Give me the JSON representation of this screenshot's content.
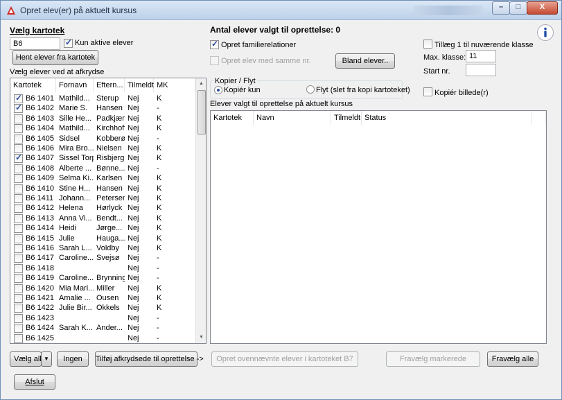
{
  "window": {
    "title": "Opret elev(er) på aktuelt kursus",
    "minimize": "–",
    "maximize": "□",
    "close": "X"
  },
  "left": {
    "heading": "Vælg kartotek",
    "kartotek_value": "B6",
    "only_active_label": "Kun aktive elever",
    "fetch_button": "Hent elever fra kartotek",
    "select_caption": "Vælg elever ved at afkrydse",
    "columns": [
      "Kartotek",
      "Fornavn",
      "Eftern...",
      "Tilmeldt",
      "MK"
    ],
    "rows": [
      {
        "checked": true,
        "kartotek": "B6  1401",
        "fornavn": "Mathild...",
        "efternavn": "Sterup",
        "tilmeldt": "Nej",
        "mk": "K"
      },
      {
        "checked": true,
        "kartotek": "B6  1402",
        "fornavn": "Marie S.",
        "efternavn": "Hansen",
        "tilmeldt": "Nej",
        "mk": "-"
      },
      {
        "checked": false,
        "kartotek": "B6  1403",
        "fornavn": "Sille He...",
        "efternavn": "Padkjær",
        "tilmeldt": "Nej",
        "mk": "K"
      },
      {
        "checked": false,
        "kartotek": "B6  1404",
        "fornavn": "Mathild...",
        "efternavn": "Kirchhoff",
        "tilmeldt": "Nej",
        "mk": "K"
      },
      {
        "checked": false,
        "kartotek": "B6  1405",
        "fornavn": "Sidsel",
        "efternavn": "Kobberø",
        "tilmeldt": "Nej",
        "mk": "-"
      },
      {
        "checked": false,
        "kartotek": "B6  1406",
        "fornavn": "Mira Bro...",
        "efternavn": "Nielsen",
        "tilmeldt": "Nej",
        "mk": "K"
      },
      {
        "checked": true,
        "kartotek": "B6  1407",
        "fornavn": "Sissel Torp",
        "efternavn": "Risbjerg",
        "tilmeldt": "Nej",
        "mk": "K"
      },
      {
        "checked": false,
        "kartotek": "B6  1408",
        "fornavn": "Alberte ...",
        "efternavn": "Bønne...",
        "tilmeldt": "Nej",
        "mk": "-"
      },
      {
        "checked": false,
        "kartotek": "B6  1409",
        "fornavn": "Selma Ki...",
        "efternavn": "Karlsen",
        "tilmeldt": "Nej",
        "mk": "K"
      },
      {
        "checked": false,
        "kartotek": "B6  1410",
        "fornavn": "Stine H...",
        "efternavn": "Hansen",
        "tilmeldt": "Nej",
        "mk": "K"
      },
      {
        "checked": false,
        "kartotek": "B6  1411",
        "fornavn": "Johann...",
        "efternavn": "Petersen",
        "tilmeldt": "Nej",
        "mk": "K"
      },
      {
        "checked": false,
        "kartotek": "B6  1412",
        "fornavn": "Helena",
        "efternavn": "Hørlyck",
        "tilmeldt": "Nej",
        "mk": "K"
      },
      {
        "checked": false,
        "kartotek": "B6  1413",
        "fornavn": "Anna Vi...",
        "efternavn": "Bendt...",
        "tilmeldt": "Nej",
        "mk": "K"
      },
      {
        "checked": false,
        "kartotek": "B6  1414",
        "fornavn": "Heidi",
        "efternavn": "Jørge...",
        "tilmeldt": "Nej",
        "mk": "K"
      },
      {
        "checked": false,
        "kartotek": "B6  1415",
        "fornavn": "Julie",
        "efternavn": "Hauga...",
        "tilmeldt": "Nej",
        "mk": "K"
      },
      {
        "checked": false,
        "kartotek": "B6  1416",
        "fornavn": "Sarah L...",
        "efternavn": "Voldby",
        "tilmeldt": "Nej",
        "mk": "K"
      },
      {
        "checked": false,
        "kartotek": "B6  1417",
        "fornavn": "Caroline...",
        "efternavn": "Svejsø",
        "tilmeldt": "Nej",
        "mk": "-"
      },
      {
        "checked": false,
        "kartotek": "B6  1418",
        "fornavn": "",
        "efternavn": "",
        "tilmeldt": "Nej",
        "mk": "-"
      },
      {
        "checked": false,
        "kartotek": "B6  1419",
        "fornavn": "Caroline...",
        "efternavn": "Brynning",
        "tilmeldt": "Nej",
        "mk": "-"
      },
      {
        "checked": false,
        "kartotek": "B6  1420",
        "fornavn": "Mia Mari...",
        "efternavn": "Miller",
        "tilmeldt": "Nej",
        "mk": "K"
      },
      {
        "checked": false,
        "kartotek": "B6  1421",
        "fornavn": "Amalie ...",
        "efternavn": "Ousen",
        "tilmeldt": "Nej",
        "mk": "K"
      },
      {
        "checked": false,
        "kartotek": "B6  1422",
        "fornavn": "Julie Bir...",
        "efternavn": "Okkels",
        "tilmeldt": "Nej",
        "mk": "K"
      },
      {
        "checked": false,
        "kartotek": "B6  1423",
        "fornavn": "",
        "efternavn": "",
        "tilmeldt": "Nej",
        "mk": "-"
      },
      {
        "checked": false,
        "kartotek": "B6  1424",
        "fornavn": "Sarah K...",
        "efternavn": "Ander...",
        "tilmeldt": "Nej",
        "mk": "-"
      },
      {
        "checked": false,
        "kartotek": "B6  1425",
        "fornavn": "",
        "efternavn": "",
        "tilmeldt": "Nej",
        "mk": "-"
      }
    ],
    "select_all_button": "Vælg alle",
    "none_button": "Ingen",
    "add_button": "Tilføj afkrydsede til oprettelse ->",
    "close_button": "Afslut"
  },
  "right": {
    "count_label": "Antal elever valgt til oprettelse: 0",
    "family_label": "Opret familierelationer",
    "same_nr_label": "Opret elev med samme nr.",
    "shuffle_button": "Bland elever..",
    "copy_move_title": "Kopier / Flyt",
    "copy_only_label": "Kopiér kun",
    "move_label": "Flyt (slet fra kopi kartoteket)",
    "add_to_class_label": "Tillæg 1 til nuværende klasse",
    "max_class_label": "Max. klasse:",
    "max_class_value": "11",
    "start_nr_label": "Start nr.",
    "start_nr_value": "",
    "copy_image_label": "Kopiér billede(r)",
    "selected_caption": "Elever valgt til oprettelse på aktuelt kursus",
    "columns": [
      "Kartotek",
      "Navn",
      "Tilmeldt",
      "Status"
    ],
    "create_button": "Opret ovennævnte elever i kartoteket B7",
    "deselect_marked_button": "Fravælg markerede",
    "deselect_all_button": "Fravælg alle"
  },
  "colors": {
    "title_text": "#1e2e44",
    "check_mark": "#2a4c9a",
    "disabled_text": "#a0a0a0",
    "info_icon": "#1f4fa8"
  }
}
